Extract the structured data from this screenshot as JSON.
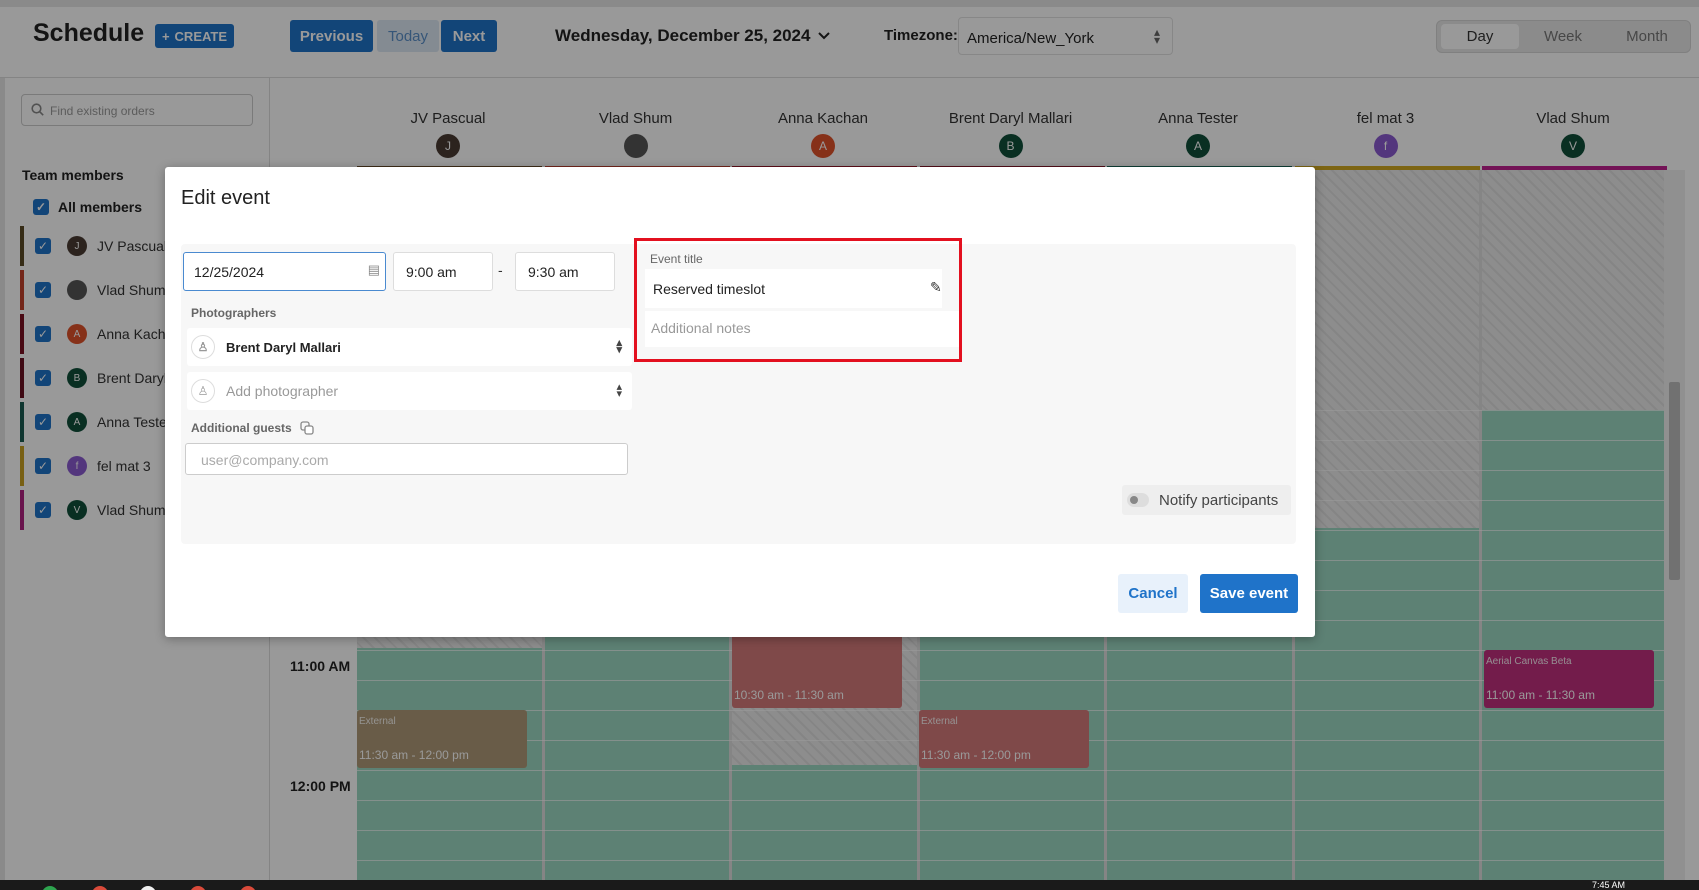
{
  "header": {
    "title": "Schedule",
    "create_label": "CREATE",
    "prev_label": "Previous",
    "today_label": "Today",
    "next_label": "Next",
    "current_date": "Wednesday, December 25, 2024",
    "timezone_label": "Timezone:",
    "timezone_value": "America/New_York",
    "views": [
      "Day",
      "Week",
      "Month"
    ],
    "active_view": "Day"
  },
  "sidebar": {
    "search_placeholder": "Find existing orders",
    "team_title": "Team members",
    "all_members_label": "All members",
    "members": [
      {
        "name": "JV Pascual",
        "initial": "J",
        "color": "#4a3b33",
        "bar": "#5a4a25"
      },
      {
        "name": "Vlad Shum",
        "initial": "",
        "color": "#555555",
        "bar": "#c0402a"
      },
      {
        "name": "Anna Kachan",
        "initial": "A",
        "color": "#e0522a",
        "bar": "#7a1020"
      },
      {
        "name": "Brent Daryl Mallari",
        "initial": "B",
        "color": "#0f4f3a",
        "bar": "#6a1020"
      },
      {
        "name": "Anna Tester",
        "initial": "A",
        "color": "#0f4f3a",
        "bar": "#1a5a50"
      },
      {
        "name": "fel mat 3",
        "initial": "f",
        "color": "#8a5bd0",
        "bar": "#c8a020"
      },
      {
        "name": "Vlad Shum",
        "initial": "V",
        "color": "#0f4f3a",
        "bar": "#b02080"
      }
    ]
  },
  "calendar": {
    "columns": [
      {
        "name": "JV Pascual",
        "initial": "J",
        "avatar": "#4a3b33",
        "bar": "#6a4a28"
      },
      {
        "name": "Vlad Shum",
        "initial": "",
        "avatar": "#555555",
        "bar": "#c04030"
      },
      {
        "name": "Anna Kachan",
        "initial": "A",
        "avatar": "#e0522a",
        "bar": "#9a1828"
      },
      {
        "name": "Brent Daryl Mallari",
        "initial": "B",
        "avatar": "#0f4f3a",
        "bar": "#8a1828"
      },
      {
        "name": "Anna Tester",
        "initial": "A",
        "avatar": "#0f4f3a",
        "bar": "#1a6a5a"
      },
      {
        "name": "fel mat 3",
        "initial": "f",
        "avatar": "#8a5bd0",
        "bar": "#d0a820"
      },
      {
        "name": "Vlad Shum",
        "initial": "V",
        "avatar": "#0f4f3a",
        "bar": "#c02090"
      }
    ],
    "hours": [
      "11:00 AM",
      "12:00 PM"
    ],
    "events": {
      "anna_kachan": {
        "time": "10:30 am - 11:30 am"
      },
      "jv_external": {
        "label": "External",
        "time": "11:30 am - 12:00 pm"
      },
      "brent_external": {
        "label": "External",
        "time": "11:30 am - 12:00 pm"
      },
      "aerial": {
        "label": "Aerial Canvas Beta",
        "time": "11:00 am - 11:30 am"
      }
    }
  },
  "modal": {
    "title": "Edit event",
    "date": "12/25/2024",
    "start_time": "9:00 am",
    "end_time": "9:30 am",
    "separator": "-",
    "photographers_label": "Photographers",
    "photographer_selected": "Brent Daryl Mallari",
    "add_photographer_placeholder": "Add photographer",
    "guests_label": "Additional guests",
    "guests_placeholder": "user@company.com",
    "event_title_label": "Event title",
    "event_title_value": "Reserved timeslot",
    "notes_placeholder": "Additional notes",
    "notify_label": "Notify participants",
    "cancel_label": "Cancel",
    "save_label": "Save event"
  },
  "taskbar": {
    "clock": "7:45 AM"
  }
}
